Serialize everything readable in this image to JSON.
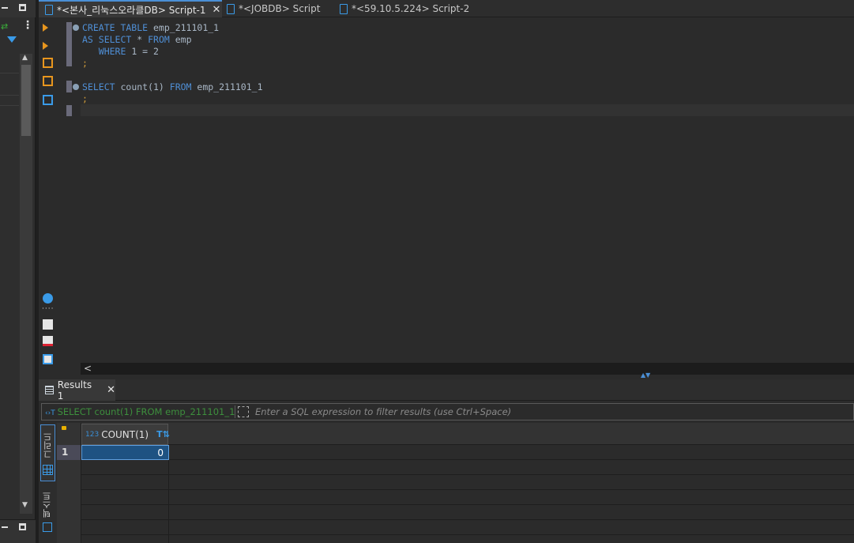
{
  "tabs": [
    {
      "label": "*<본사_리눅스오라클DB> Script-1",
      "active": true,
      "closable": true
    },
    {
      "label": "*<JOBDB> Script",
      "active": false
    },
    {
      "label": "*<59.10.5.224> Script-2",
      "active": false
    }
  ],
  "editor": {
    "lines": [
      {
        "parts": [
          [
            "kw",
            "CREATE TABLE "
          ],
          [
            "id",
            "emp_211101_1"
          ]
        ]
      },
      {
        "parts": [
          [
            "kw",
            "AS SELECT "
          ],
          [
            "id",
            "* "
          ],
          [
            "kw",
            "FROM "
          ],
          [
            "id",
            "emp"
          ]
        ]
      },
      {
        "parts": [
          [
            "kw",
            "   WHERE "
          ],
          [
            "id",
            "1 = 2"
          ]
        ]
      },
      {
        "parts": [
          [
            "semi",
            ";"
          ]
        ]
      },
      {
        "parts": [
          [
            "kw",
            "SELECT "
          ],
          [
            "id",
            "count(1) "
          ],
          [
            "kw",
            "FROM "
          ],
          [
            "id",
            "emp_211101_1"
          ]
        ]
      },
      {
        "parts": [
          [
            "semi",
            ";"
          ]
        ]
      }
    ]
  },
  "results": {
    "tab_label": "Results 1",
    "filter_sql": "SELECT count(1) FROM emp_211101_1",
    "filter_placeholder": "Enter a SQL expression to filter results (use Ctrl+Space)",
    "vertical_tabs": {
      "grid": "그리드",
      "text": "텍스트"
    },
    "columns": [
      {
        "type": "123",
        "name": "COUNT(1)"
      }
    ],
    "rows": [
      {
        "num": "1",
        "values": [
          "0"
        ]
      }
    ]
  },
  "icons": {
    "accent": "#4a8fd6",
    "run": "run-icon",
    "script": "script-icon"
  }
}
